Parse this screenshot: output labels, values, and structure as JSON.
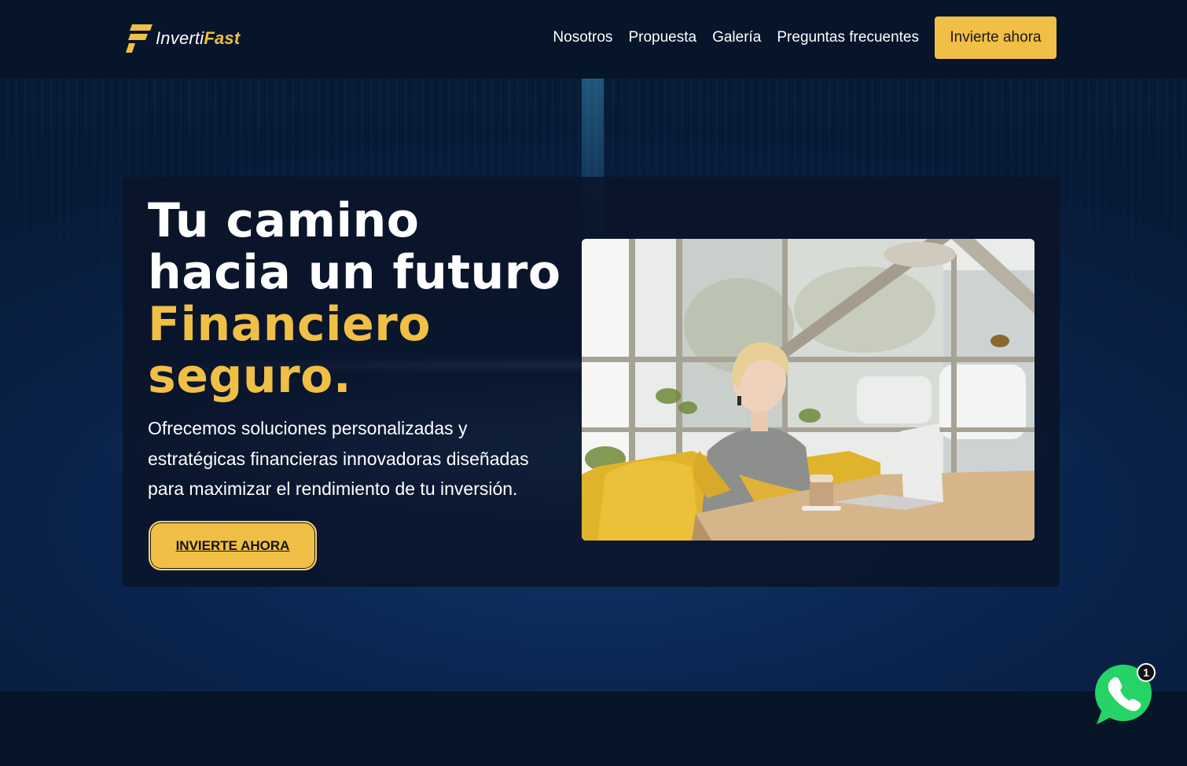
{
  "brand": {
    "name_light": "Inverti",
    "name_bold": "Fast",
    "accent_color": "#f0bf45",
    "icon": "invertifast-logo-icon"
  },
  "nav": {
    "items": [
      {
        "label": "Nosotros"
      },
      {
        "label": "Propuesta"
      },
      {
        "label": "Galería"
      },
      {
        "label": "Preguntas frecuentes"
      }
    ],
    "cta_label": "Invierte ahora"
  },
  "hero": {
    "title_lines": [
      "Tu camino",
      "hacia un futuro"
    ],
    "title_highlight_lines": [
      "Financiero",
      "seguro."
    ],
    "description": "Ofrecemos soluciones personalizadas y estratégicas financieras innovadoras diseñadas para maximizar el rendimiento de tu inversión.",
    "button_label": "INVIERTE AHORA",
    "image": "woman-working-on-laptop-in-cafe-photo"
  },
  "whatsapp": {
    "icon": "whatsapp-icon",
    "badge_count": "1"
  }
}
